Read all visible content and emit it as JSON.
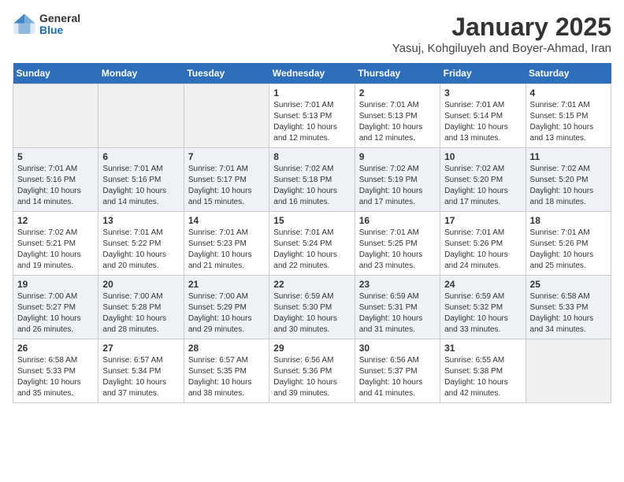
{
  "header": {
    "logo": {
      "general": "General",
      "blue": "Blue"
    },
    "title": "January 2025",
    "location": "Yasuj, Kohgiluyeh and Boyer-Ahmad, Iran"
  },
  "days_of_week": [
    "Sunday",
    "Monday",
    "Tuesday",
    "Wednesday",
    "Thursday",
    "Friday",
    "Saturday"
  ],
  "weeks": [
    {
      "days": [
        {
          "num": "",
          "content": ""
        },
        {
          "num": "",
          "content": ""
        },
        {
          "num": "",
          "content": ""
        },
        {
          "num": "1",
          "content": "Sunrise: 7:01 AM\nSunset: 5:13 PM\nDaylight: 10 hours\nand 12 minutes."
        },
        {
          "num": "2",
          "content": "Sunrise: 7:01 AM\nSunset: 5:13 PM\nDaylight: 10 hours\nand 12 minutes."
        },
        {
          "num": "3",
          "content": "Sunrise: 7:01 AM\nSunset: 5:14 PM\nDaylight: 10 hours\nand 13 minutes."
        },
        {
          "num": "4",
          "content": "Sunrise: 7:01 AM\nSunset: 5:15 PM\nDaylight: 10 hours\nand 13 minutes."
        }
      ]
    },
    {
      "days": [
        {
          "num": "5",
          "content": "Sunrise: 7:01 AM\nSunset: 5:16 PM\nDaylight: 10 hours\nand 14 minutes."
        },
        {
          "num": "6",
          "content": "Sunrise: 7:01 AM\nSunset: 5:16 PM\nDaylight: 10 hours\nand 14 minutes."
        },
        {
          "num": "7",
          "content": "Sunrise: 7:01 AM\nSunset: 5:17 PM\nDaylight: 10 hours\nand 15 minutes."
        },
        {
          "num": "8",
          "content": "Sunrise: 7:02 AM\nSunset: 5:18 PM\nDaylight: 10 hours\nand 16 minutes."
        },
        {
          "num": "9",
          "content": "Sunrise: 7:02 AM\nSunset: 5:19 PM\nDaylight: 10 hours\nand 17 minutes."
        },
        {
          "num": "10",
          "content": "Sunrise: 7:02 AM\nSunset: 5:20 PM\nDaylight: 10 hours\nand 17 minutes."
        },
        {
          "num": "11",
          "content": "Sunrise: 7:02 AM\nSunset: 5:20 PM\nDaylight: 10 hours\nand 18 minutes."
        }
      ]
    },
    {
      "days": [
        {
          "num": "12",
          "content": "Sunrise: 7:02 AM\nSunset: 5:21 PM\nDaylight: 10 hours\nand 19 minutes."
        },
        {
          "num": "13",
          "content": "Sunrise: 7:01 AM\nSunset: 5:22 PM\nDaylight: 10 hours\nand 20 minutes."
        },
        {
          "num": "14",
          "content": "Sunrise: 7:01 AM\nSunset: 5:23 PM\nDaylight: 10 hours\nand 21 minutes."
        },
        {
          "num": "15",
          "content": "Sunrise: 7:01 AM\nSunset: 5:24 PM\nDaylight: 10 hours\nand 22 minutes."
        },
        {
          "num": "16",
          "content": "Sunrise: 7:01 AM\nSunset: 5:25 PM\nDaylight: 10 hours\nand 23 minutes."
        },
        {
          "num": "17",
          "content": "Sunrise: 7:01 AM\nSunset: 5:26 PM\nDaylight: 10 hours\nand 24 minutes."
        },
        {
          "num": "18",
          "content": "Sunrise: 7:01 AM\nSunset: 5:26 PM\nDaylight: 10 hours\nand 25 minutes."
        }
      ]
    },
    {
      "days": [
        {
          "num": "19",
          "content": "Sunrise: 7:00 AM\nSunset: 5:27 PM\nDaylight: 10 hours\nand 26 minutes."
        },
        {
          "num": "20",
          "content": "Sunrise: 7:00 AM\nSunset: 5:28 PM\nDaylight: 10 hours\nand 28 minutes."
        },
        {
          "num": "21",
          "content": "Sunrise: 7:00 AM\nSunset: 5:29 PM\nDaylight: 10 hours\nand 29 minutes."
        },
        {
          "num": "22",
          "content": "Sunrise: 6:59 AM\nSunset: 5:30 PM\nDaylight: 10 hours\nand 30 minutes."
        },
        {
          "num": "23",
          "content": "Sunrise: 6:59 AM\nSunset: 5:31 PM\nDaylight: 10 hours\nand 31 minutes."
        },
        {
          "num": "24",
          "content": "Sunrise: 6:59 AM\nSunset: 5:32 PM\nDaylight: 10 hours\nand 33 minutes."
        },
        {
          "num": "25",
          "content": "Sunrise: 6:58 AM\nSunset: 5:33 PM\nDaylight: 10 hours\nand 34 minutes."
        }
      ]
    },
    {
      "days": [
        {
          "num": "26",
          "content": "Sunrise: 6:58 AM\nSunset: 5:33 PM\nDaylight: 10 hours\nand 35 minutes."
        },
        {
          "num": "27",
          "content": "Sunrise: 6:57 AM\nSunset: 5:34 PM\nDaylight: 10 hours\nand 37 minutes."
        },
        {
          "num": "28",
          "content": "Sunrise: 6:57 AM\nSunset: 5:35 PM\nDaylight: 10 hours\nand 38 minutes."
        },
        {
          "num": "29",
          "content": "Sunrise: 6:56 AM\nSunset: 5:36 PM\nDaylight: 10 hours\nand 39 minutes."
        },
        {
          "num": "30",
          "content": "Sunrise: 6:56 AM\nSunset: 5:37 PM\nDaylight: 10 hours\nand 41 minutes."
        },
        {
          "num": "31",
          "content": "Sunrise: 6:55 AM\nSunset: 5:38 PM\nDaylight: 10 hours\nand 42 minutes."
        },
        {
          "num": "",
          "content": ""
        }
      ]
    }
  ]
}
